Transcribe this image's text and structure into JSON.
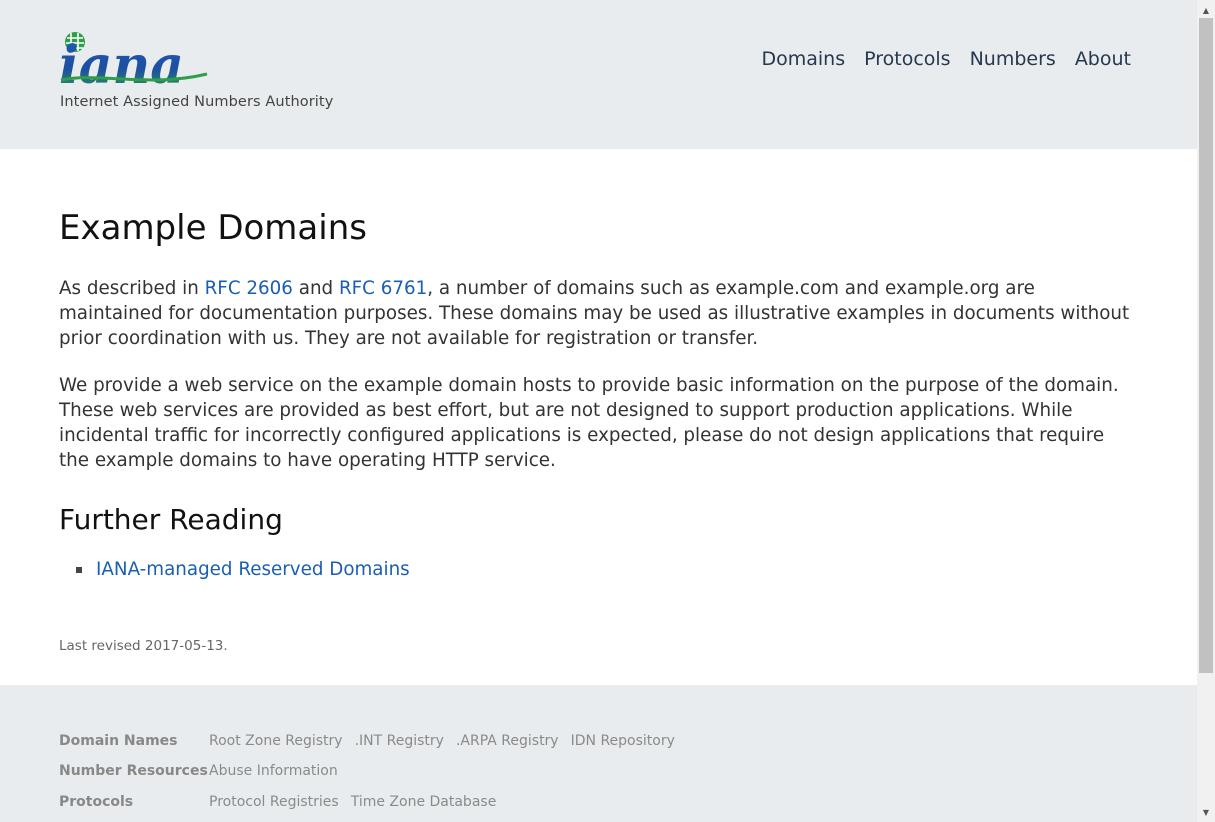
{
  "header": {
    "logo_text": "iana",
    "tagline": "Internet Assigned Numbers Authority",
    "nav": [
      {
        "label": "Domains"
      },
      {
        "label": "Protocols"
      },
      {
        "label": "Numbers"
      },
      {
        "label": "About"
      }
    ]
  },
  "main": {
    "title": "Example Domains",
    "para1": {
      "t1": "As described in ",
      "link1": "RFC 2606",
      "t2": " and ",
      "link2": "RFC 6761",
      "t3": ", a number of domains such as example.com and example.org are maintained for documentation purposes. These domains may be used as illustrative examples in documents without prior coordination with us. They are not available for registration or transfer."
    },
    "para2": "We provide a web service on the example domain hosts to provide basic information on the purpose of the domain. These web services are provided as best effort, but are not designed to support production applications. While incidental traffic for incorrectly configured applications is expected, please do not design applications that require the example domains to have operating HTTP service.",
    "further_reading_title": "Further Reading",
    "further_reading_items": [
      "IANA-managed Reserved Domains"
    ],
    "last_revised": "Last revised 2017-05-13."
  },
  "footer": {
    "rows": [
      {
        "label": "Domain Names",
        "links": [
          "Root Zone Registry",
          ".INT Registry",
          ".ARPA Registry",
          "IDN Repository"
        ]
      },
      {
        "label": "Number Resources",
        "links": [
          "Abuse Information"
        ]
      },
      {
        "label": "Protocols",
        "links": [
          "Protocol Registries",
          "Time Zone Database"
        ]
      }
    ]
  },
  "colors": {
    "header_bg": "#e9ecee",
    "link": "#1a5fb4",
    "nav_text": "#27374e",
    "logo_blue": "#1d4fa3",
    "logo_green": "#2e9e4a"
  }
}
